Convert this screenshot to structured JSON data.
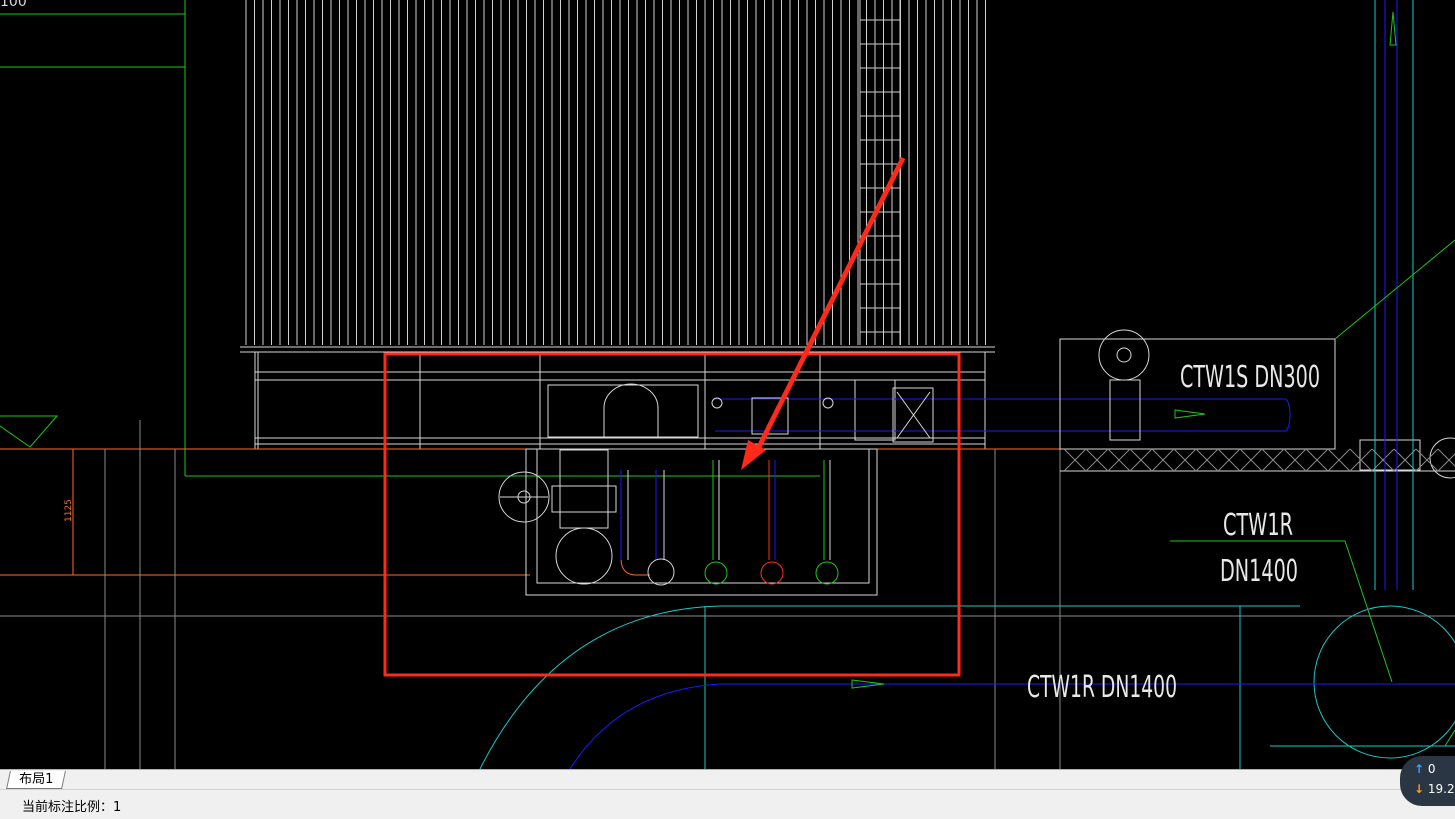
{
  "drawing": {
    "top_left_text": "100",
    "dimension_label": "1125",
    "pipe_label_ctw1s": "CTW1S DN300",
    "pipe_label_ctw1r_line1": "CTW1R",
    "pipe_label_ctw1r_line2": "DN1400",
    "pipe_label_ctw1r_bottom": "CTW1R DN1400"
  },
  "annotation": {
    "highlight_color": "#ff2a1a",
    "arrow_color": "#ff2a1a"
  },
  "tabs": {
    "layout_tab": "布局1"
  },
  "status": {
    "scale_text": "当前标注比例：1"
  },
  "net": {
    "upload": "0",
    "download": "19.2"
  },
  "colors": {
    "background": "#000000",
    "structure": "#d8d8d8",
    "green": "#19c819",
    "blue": "#1a1aff",
    "cyan": "#19c8c8",
    "red": "#ff2a1a",
    "orange_dim": "#ff6a2a"
  }
}
